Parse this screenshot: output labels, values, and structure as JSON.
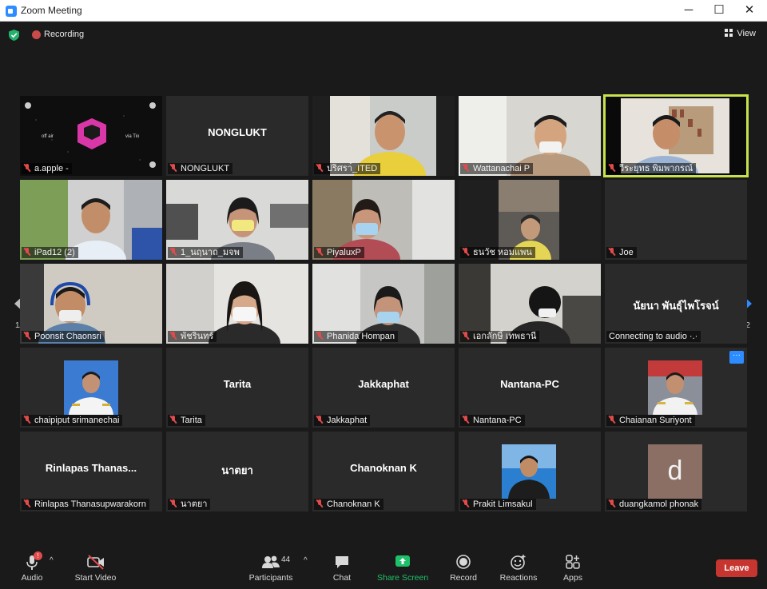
{
  "window": {
    "title": "Zoom Meeting"
  },
  "topbar": {
    "recording_label": "Recording",
    "view_label": "View"
  },
  "gallery": {
    "page_left": "1/2",
    "page_right": "1/2",
    "tiles": [
      {
        "label": "a.apple -",
        "video": "logo"
      },
      {
        "label": "NONGLUKT",
        "big_name": "NONGLUKT"
      },
      {
        "label": "ปริศรา้_ITED",
        "video": "camera"
      },
      {
        "label": "Wattanachai P",
        "video": "camera"
      },
      {
        "label": "วีระยุทธ พิมพากรณ์",
        "video": "camera",
        "active": true
      },
      {
        "label": "iPad12 (2)",
        "video": "camera"
      },
      {
        "label": "1_นฤนาถ_มจพ",
        "video": "camera"
      },
      {
        "label": "PiyaluxP",
        "video": "camera"
      },
      {
        "label": "ธนวัช หอมแพน",
        "video": "camera"
      },
      {
        "label": "Joe"
      },
      {
        "label": "Poonsit Chaonsri",
        "video": "camera"
      },
      {
        "label": "พัชรินทร์",
        "video": "camera"
      },
      {
        "label": "Phanida Hompan",
        "video": "camera"
      },
      {
        "label": "เอกลักษิ์ เทพธานี",
        "video": "camera"
      },
      {
        "label": "Connecting to audio ·.·",
        "big_name": "นัยนา พันธุ์ไพโรจน์"
      },
      {
        "label": "chaipiput srimanechai",
        "video": "profile"
      },
      {
        "label": "Tarita",
        "big_name": "Tarita"
      },
      {
        "label": "Jakkaphat",
        "big_name": "Jakkaphat"
      },
      {
        "label": "Nantana-PC",
        "big_name": "Nantana-PC"
      },
      {
        "label": "Chaianan Suriyont",
        "video": "profile"
      },
      {
        "label": "Rinlapas Thanasupwarakorn",
        "big_name": "Rinlapas  Thanas..."
      },
      {
        "label": "นาตยา",
        "big_name": "นาตยา"
      },
      {
        "label": "Chanoknan K",
        "big_name": "Chanoknan K"
      },
      {
        "label": "Prakit Limsakul",
        "video": "profile"
      },
      {
        "label": "duangkamol phonak",
        "avatar_letter": "d"
      }
    ]
  },
  "toolbar": {
    "audio": "Audio",
    "audio_badge": "!",
    "start_video": "Start Video",
    "participants": "Participants",
    "participants_count": "44",
    "chat": "Chat",
    "share_screen": "Share Screen",
    "record": "Record",
    "reactions": "Reactions",
    "apps": "Apps",
    "leave": "Leave",
    "more_dots": "···"
  },
  "colors": {
    "accent_blue": "#2d8cff",
    "active_speaker": "#c7e24d",
    "share_green": "#1fc06a",
    "leave_red": "#c6352f",
    "muted_red": "#e14b4b"
  }
}
